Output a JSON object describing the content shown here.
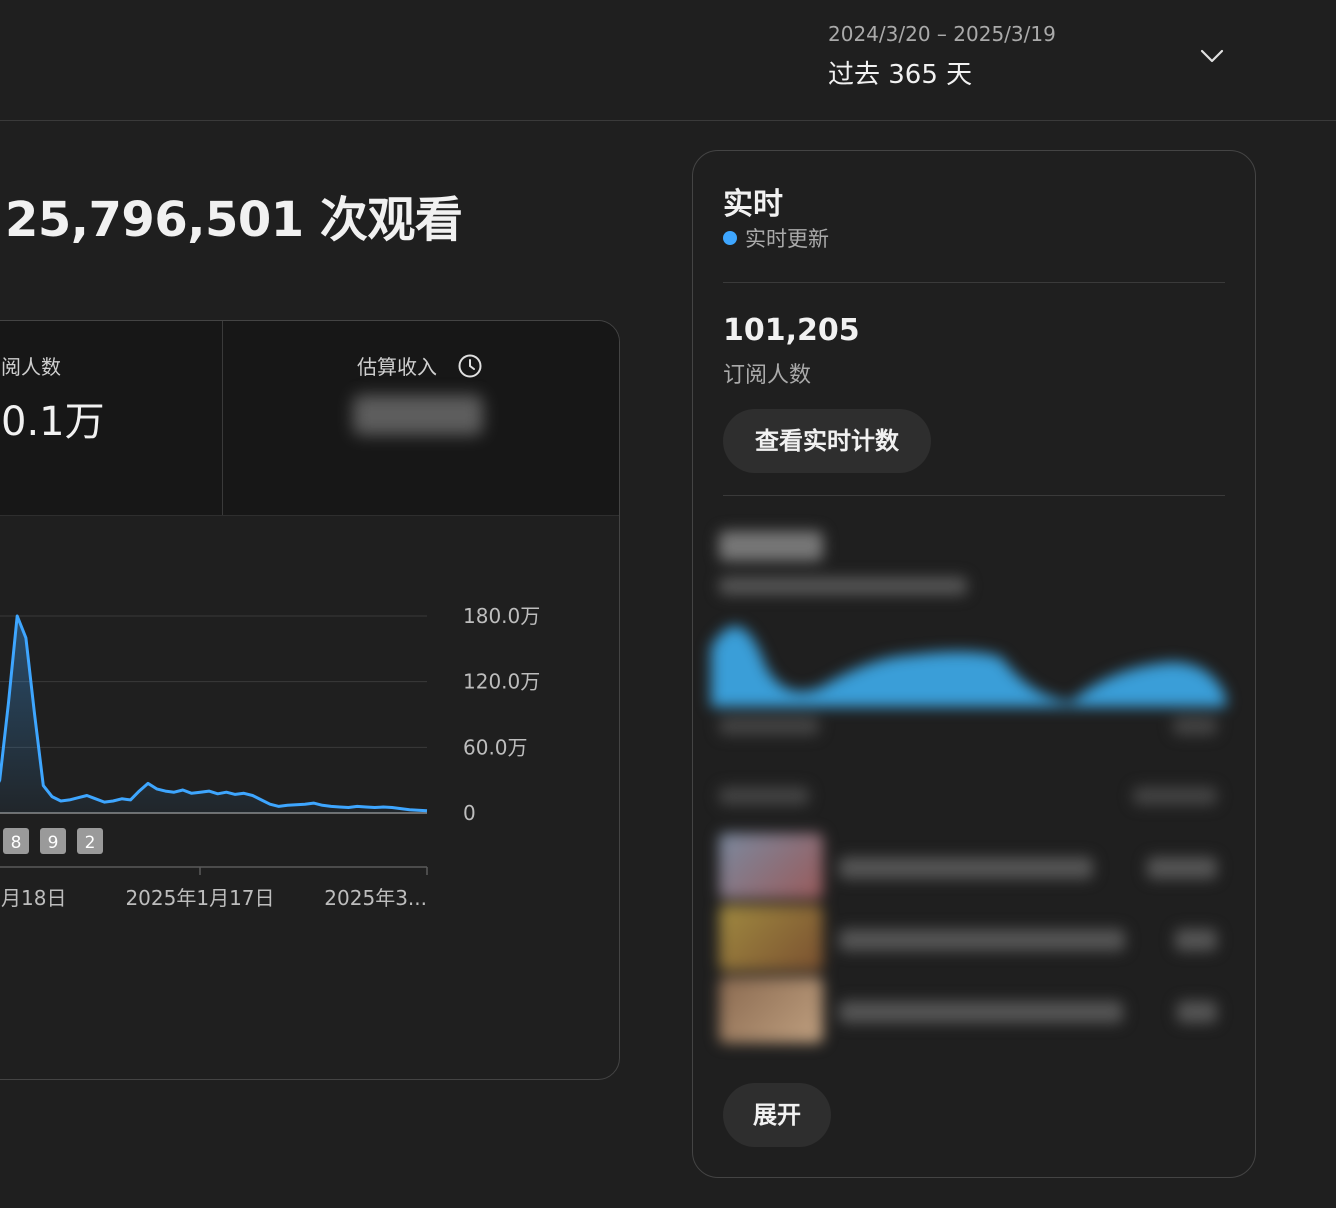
{
  "header": {
    "date_range": "2024/3/20 – 2025/3/19",
    "period": "过去 365 天"
  },
  "overview": {
    "views_title": "25,796,501 次观看"
  },
  "metrics": {
    "subscribers_label": "阅人数",
    "subscribers_value": "0.1万",
    "revenue_label": "估算收入"
  },
  "chart_data": {
    "type": "line",
    "color": "#3ea6ff",
    "y_tick_labels": [
      "180.0万",
      "120.0万",
      "60.0万",
      "0"
    ],
    "ylim": [
      0,
      1800000
    ],
    "x_tick_labels": [
      "月18日",
      "2025年1月17日",
      "2025年3..."
    ],
    "markers": [
      "8",
      "9",
      "2"
    ],
    "series": [
      {
        "values": [
          150000,
          300000,
          1000000,
          1800000,
          1600000,
          900000,
          250000,
          150000,
          110000,
          120000,
          140000,
          160000,
          130000,
          100000,
          110000,
          130000,
          120000,
          200000,
          270000,
          220000,
          200000,
          190000,
          210000,
          180000,
          190000,
          200000,
          175000,
          190000,
          170000,
          180000,
          160000,
          120000,
          80000,
          60000,
          70000,
          75000,
          80000,
          90000,
          70000,
          60000,
          55000,
          50000,
          60000,
          55000,
          50000,
          55000,
          50000,
          40000,
          30000,
          25000,
          20000
        ]
      }
    ]
  },
  "realtime": {
    "title": "实时",
    "status": "实时更新",
    "subscriber_count": "101,205",
    "subscriber_label": "订阅人数",
    "view_count_button": "查看实时计数",
    "expand_button": "展开"
  }
}
